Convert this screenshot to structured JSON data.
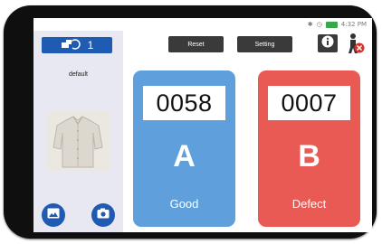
{
  "status_bar": {
    "time": "4:32 PM"
  },
  "sidebar": {
    "device_count": "1",
    "profile_name": "default",
    "photo_alt": "shirt",
    "gallery_icon": "image-gallery-icon",
    "camera_icon": "camera-icon"
  },
  "toolbar": {
    "reset_label": "Reset",
    "setting_label": "Setting",
    "info_icon": "info-icon",
    "exit_icon": "exit-person-icon"
  },
  "counters": [
    {
      "value": "0058",
      "letter": "A",
      "label": "Good",
      "color": "#5e9fdc"
    },
    {
      "value": "0007",
      "letter": "B",
      "label": "Defect",
      "color": "#e95a55"
    }
  ],
  "colors": {
    "accent": "#1f5bb3",
    "toolbar_button": "#3a3a3a",
    "sidebar_bg": "#e7e8f2"
  }
}
